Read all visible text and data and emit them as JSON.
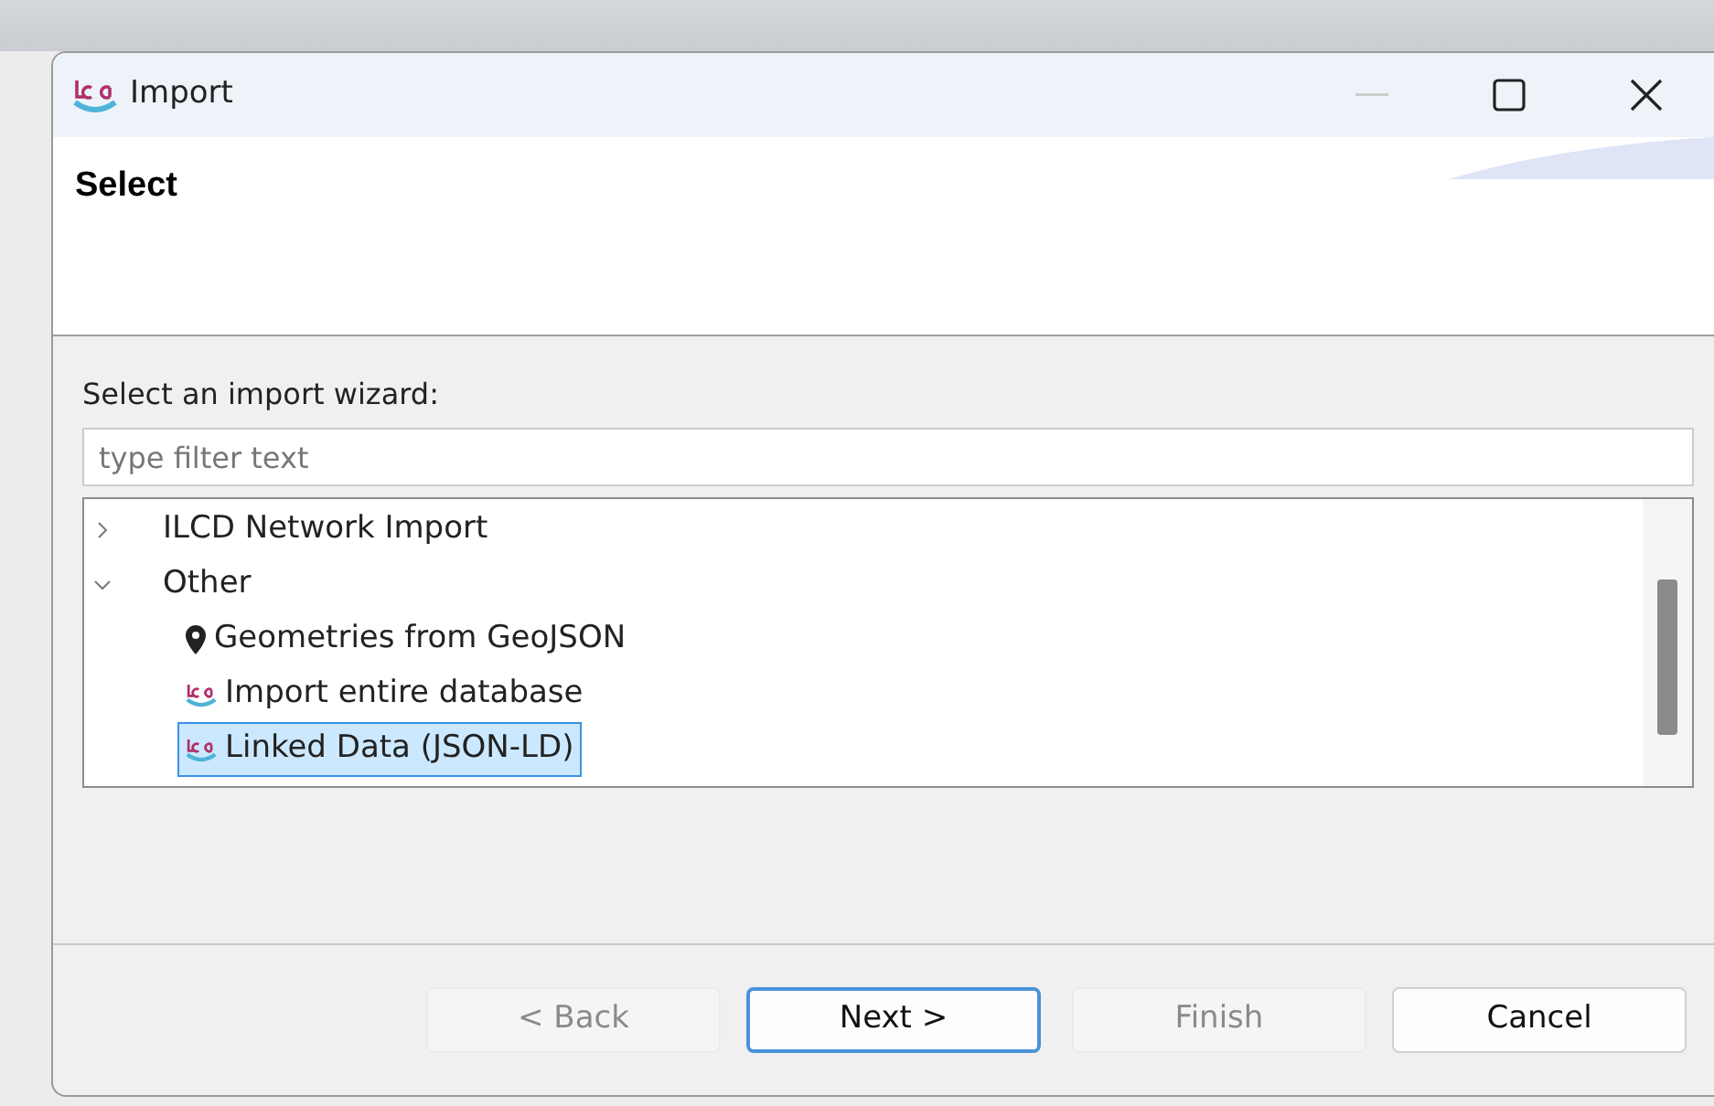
{
  "window": {
    "title": "Import"
  },
  "header": {
    "title": "Select"
  },
  "prompt": "Select an import wizard:",
  "filter": {
    "placeholder": "type filter text"
  },
  "tree": [
    {
      "label": "ILCD Network Import",
      "expanded": false,
      "selected": false
    },
    {
      "label": "Other",
      "expanded": true,
      "selected": false,
      "children": [
        {
          "label": "Geometries from GeoJSON",
          "kind": "pin",
          "selected": false
        },
        {
          "label": "Import entire database",
          "kind": "lca",
          "selected": false
        },
        {
          "label": "Linked Data (JSON-LD)",
          "kind": "lca",
          "selected": true
        }
      ]
    }
  ],
  "buttons": [
    {
      "label": "< Back",
      "disabled": true,
      "default": false
    },
    {
      "label": "Next >",
      "disabled": false,
      "default": true
    },
    {
      "label": "Finish",
      "disabled": true,
      "default": false
    },
    {
      "label": "Cancel",
      "disabled": false,
      "default": false
    }
  ]
}
